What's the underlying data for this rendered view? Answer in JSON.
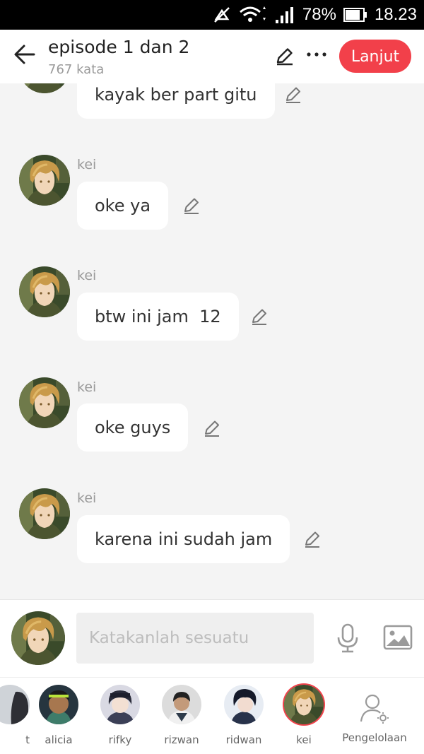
{
  "status_bar": {
    "battery": "78%",
    "time": "18.23",
    "icons": [
      "mute-icon",
      "wifi-icon",
      "signal-icon",
      "battery-icon"
    ]
  },
  "header": {
    "title": "episode 1 dan 2",
    "subtitle": "767 kata",
    "next_button": "Lanjut",
    "icons": [
      "back-arrow-icon",
      "pencil-icon",
      "more-icon"
    ]
  },
  "messages": [
    {
      "sender": "",
      "text": "kayak ber part gitu"
    },
    {
      "sender": "kei",
      "text": "oke ya"
    },
    {
      "sender": "kei",
      "text": "btw ini jam  12"
    },
    {
      "sender": "kei",
      "text": "oke guys"
    },
    {
      "sender": "kei",
      "text": "karena ini sudah jam"
    }
  ],
  "input": {
    "placeholder": "Katakanlah sesuatu",
    "value": "",
    "icons": [
      "microphone-icon",
      "image-icon"
    ]
  },
  "characters": [
    {
      "name": "t"
    },
    {
      "name": "alicia"
    },
    {
      "name": "rifky"
    },
    {
      "name": "rizwan"
    },
    {
      "name": "ridwan"
    },
    {
      "name": "kei",
      "selected": true
    }
  ],
  "management": {
    "label": "Pengelolaan",
    "icon": "user-settings-icon"
  },
  "colors": {
    "accent": "#f2404a",
    "background": "#f4f4f4",
    "bubble": "#ffffff"
  }
}
